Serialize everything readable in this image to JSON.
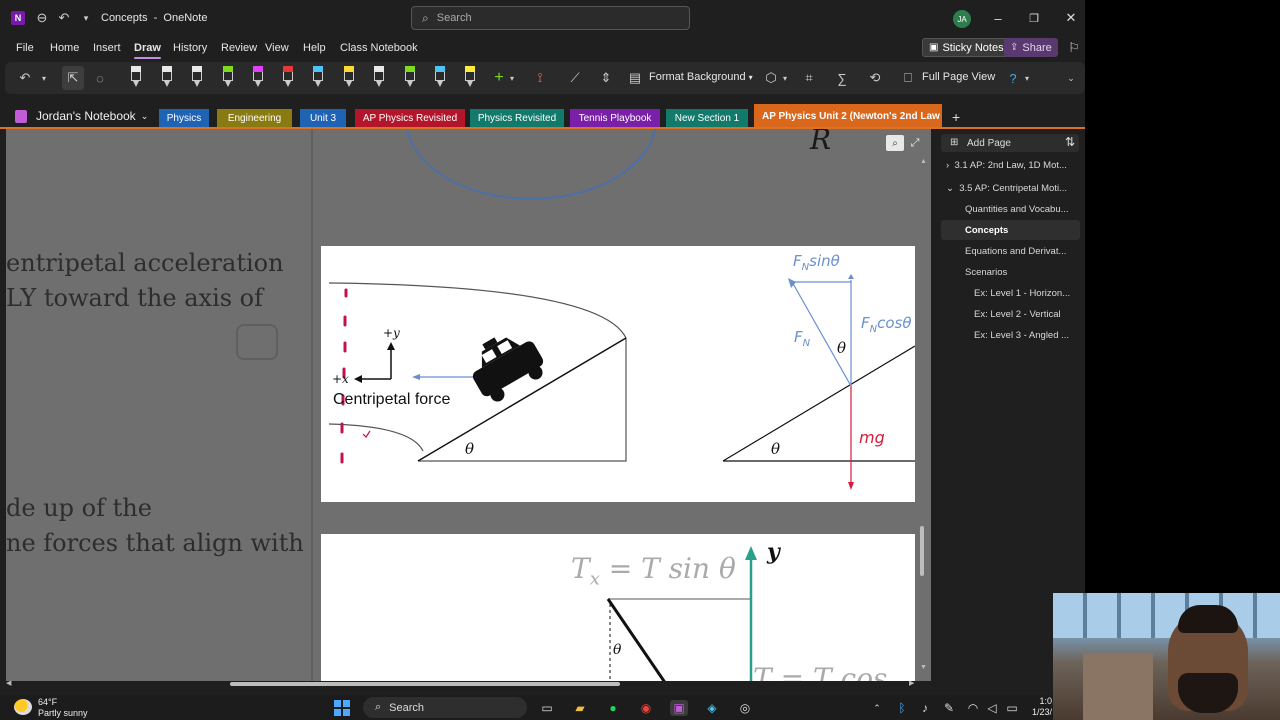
{
  "titlebar": {
    "doc_title": "Concepts",
    "app_name": "OneNote",
    "title_separator": "-",
    "search_placeholder": "Search",
    "avatar_initials": "JA"
  },
  "menu": {
    "items": [
      "File",
      "Home",
      "Insert",
      "Draw",
      "History",
      "Review",
      "View",
      "Help",
      "Class Notebook"
    ],
    "active": "Draw",
    "sticky_notes": "Sticky Notes",
    "share": "Share"
  },
  "ribbon": {
    "format_background": "Format Background",
    "full_page_view": "Full Page View",
    "pen_colors": [
      "#e8e8e8",
      "#e8e8e8",
      "#e8e8e8",
      "#7ddc1f",
      "#e040fb",
      "#e53935",
      "#4fc3f7",
      "#fdd835",
      "#e8e8e8",
      "#7ddc1f",
      "#4fc3f7",
      "#ffeb3b"
    ]
  },
  "sections": {
    "notebook": "Jordan's Notebook",
    "tabs": [
      {
        "label": "Physics",
        "color": "#1f63b5"
      },
      {
        "label": "Engineering",
        "color": "#8a7a12"
      },
      {
        "label": "Unit 3",
        "color": "#1f63b5"
      },
      {
        "label": "AP Physics Revisited",
        "color": "#b3152a"
      },
      {
        "label": "Physics Revisited",
        "color": "#127a6b"
      },
      {
        "label": "Tennis Playbook",
        "color": "#7a1fa8"
      },
      {
        "label": "New Section 1",
        "color": "#127a6b"
      },
      {
        "label": "AP Physics Unit 2 (Newton's 2nd Law ...",
        "color": "#d9671c"
      }
    ]
  },
  "canvas": {
    "text1": "entripetal acceleration",
    "text2": "LY toward the axis of",
    "text3": "de up of the",
    "text4": "ne forces that align with",
    "partial_R": "R",
    "diagram1": {
      "plus_y": "+y",
      "plus_x": "+x",
      "centripetal": "Centripetal force",
      "theta": "θ",
      "fn_sin": "FNsinθ",
      "fn_cos": "FNcosθ",
      "fn": "FN",
      "mg": "mg"
    },
    "diagram2": {
      "tx_eq": "Tx = T sin θ",
      "y_label": "y",
      "theta": "θ",
      "t_cos": "T = T cos"
    }
  },
  "navpane": {
    "add_page": "Add Page",
    "pages": [
      {
        "label": "3.1 AP: 2nd Law, 1D Mot...",
        "level": 0,
        "chevron": "›"
      },
      {
        "label": "3.5 AP: Centripetal Moti...",
        "level": 0,
        "chevron": "⌄"
      },
      {
        "label": "Quantities and Vocabu...",
        "level": 1
      },
      {
        "label": "Concepts",
        "level": 1,
        "selected": true
      },
      {
        "label": "Equations and Derivat...",
        "level": 1
      },
      {
        "label": "Scenarios",
        "level": 1
      },
      {
        "label": "Ex: Level 1 - Horizon...",
        "level": 2
      },
      {
        "label": "Ex: Level 2 - Vertical",
        "level": 2
      },
      {
        "label": "Ex: Level 3 - Angled ...",
        "level": 2
      }
    ]
  },
  "taskbar": {
    "temp": "64°F",
    "weather": "Partly sunny",
    "search": "Search",
    "time": "1:0",
    "date": "1/23/"
  }
}
